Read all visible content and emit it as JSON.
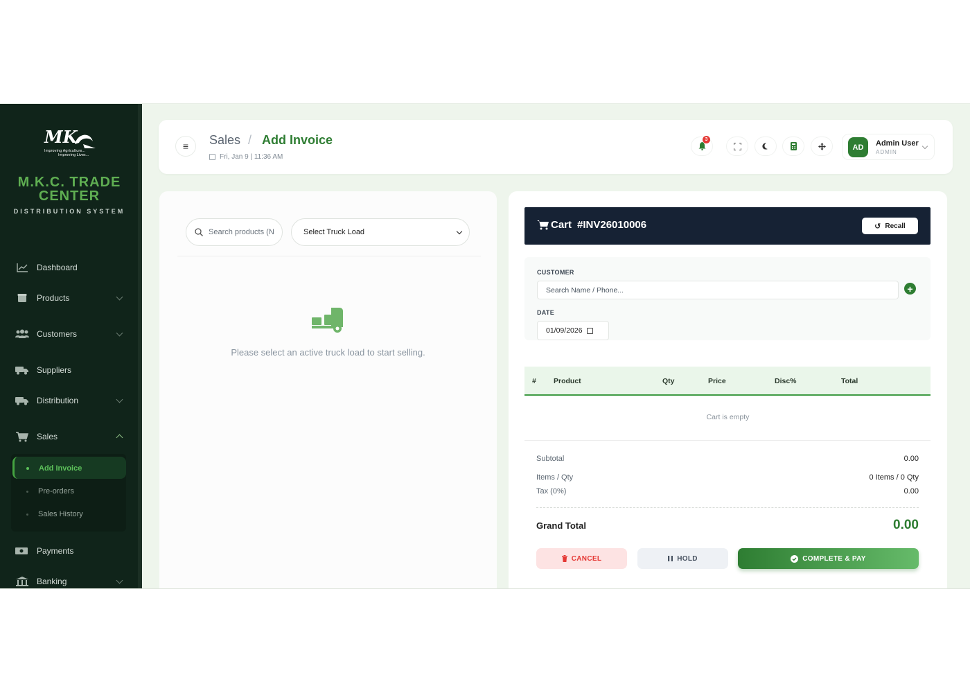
{
  "sidebar": {
    "brand_name": "M.K.C. TRADE CENTER",
    "brand_sub": "DISTRIBUTION SYSTEM",
    "logo_text": "MKC",
    "logo_tagline": "Improving Agriculture... Improving Lives...",
    "items": [
      {
        "label": "Dashboard",
        "icon": "chart-icon"
      },
      {
        "label": "Products",
        "icon": "box-icon"
      },
      {
        "label": "Customers",
        "icon": "users-icon"
      },
      {
        "label": "Suppliers",
        "icon": "truck-icon"
      },
      {
        "label": "Distribution",
        "icon": "truck-icon"
      },
      {
        "label": "Sales",
        "icon": "cart-icon"
      },
      {
        "label": "Payments",
        "icon": "money-icon"
      },
      {
        "label": "Banking",
        "icon": "bank-icon"
      }
    ],
    "sales_submenu": [
      {
        "label": "Add Invoice",
        "active": true
      },
      {
        "label": "Pre-orders",
        "active": false
      },
      {
        "label": "Sales History",
        "active": false
      }
    ]
  },
  "header": {
    "breadcrumb_root": "Sales",
    "breadcrumb_separator": "/",
    "breadcrumb_current": "Add Invoice",
    "datetime": "Fri, Jan 9 | 11:36 AM",
    "notification_count": "3",
    "user": {
      "initials": "AD",
      "name": "Admin User",
      "role": "ADMIN"
    }
  },
  "left_panel": {
    "search_placeholder": "Search products (N",
    "truck_select_value": "Select Truck Load",
    "empty_message": "Please select an active truck load to start selling."
  },
  "cart": {
    "title": "Cart",
    "invoice_no": "#INV26010006",
    "recall_label": "Recall",
    "customer_label": "CUSTOMER",
    "customer_placeholder": "Search Name / Phone...",
    "date_label": "DATE",
    "date_value": "01/09/2026",
    "columns": [
      "#",
      "Product",
      "Qty",
      "Price",
      "Disc%",
      "Total"
    ],
    "empty_text": "Cart is empty",
    "summary": {
      "subtotal_label": "Subtotal",
      "subtotal_value": "0.00",
      "items_label": "Items / Qty",
      "items_value": "0 Items / 0 Qty",
      "tax_label": "Tax (0%)",
      "tax_value": "0.00",
      "grand_label": "Grand Total",
      "grand_value": "0.00"
    },
    "buttons": {
      "cancel": "CANCEL",
      "hold": "HOLD",
      "complete": "COMPLETE & PAY"
    }
  },
  "colors": {
    "brand_green": "#2e7d32",
    "sidebar_bg": "#10241a",
    "cart_header_bg": "#162234",
    "danger": "#e53935"
  }
}
